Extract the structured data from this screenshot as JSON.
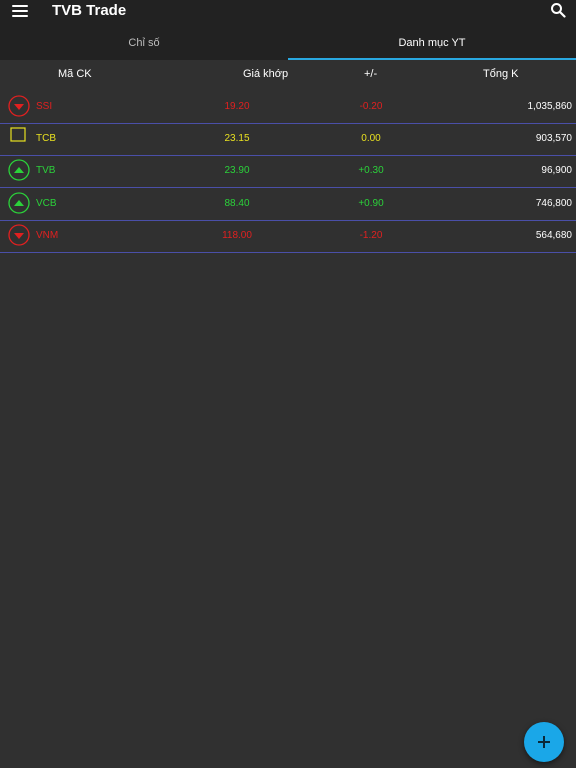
{
  "app": {
    "title": "TVB Trade"
  },
  "tabs": [
    {
      "label": "Chỉ số"
    },
    {
      "label": "Danh mục YT"
    }
  ],
  "table": {
    "headers": {
      "symbol": "Mã CK",
      "price": "Giá khớp",
      "change": "+/-",
      "volume": "Tổng K"
    },
    "rows": [
      {
        "symbol": "SSI",
        "price": "19.20",
        "change": "-0.20",
        "volume": "1,035,860",
        "trend": "down"
      },
      {
        "symbol": "TCB",
        "price": "23.15",
        "change": "0.00",
        "volume": "903,570",
        "trend": "unchanged"
      },
      {
        "symbol": "TVB",
        "price": "23.90",
        "change": "+0.30",
        "volume": "96,900",
        "trend": "up"
      },
      {
        "symbol": "VCB",
        "price": "88.40",
        "change": "+0.90",
        "volume": "746,800",
        "trend": "up"
      },
      {
        "symbol": "VNM",
        "price": "118.00",
        "change": "-1.20",
        "volume": "564,680",
        "trend": "down"
      }
    ]
  },
  "colors": {
    "down": "#e02020",
    "up": "#2bd13a",
    "unchanged": "#e8e020",
    "accent": "#29a8e0",
    "row_divider": "#4a4fa8"
  },
  "icons": {
    "menu": "menu-icon",
    "search": "search-icon",
    "down": "arrow-down-circle-icon",
    "up": "arrow-up-circle-icon",
    "unchanged": "square-outline-icon",
    "fab": "plus-icon"
  }
}
